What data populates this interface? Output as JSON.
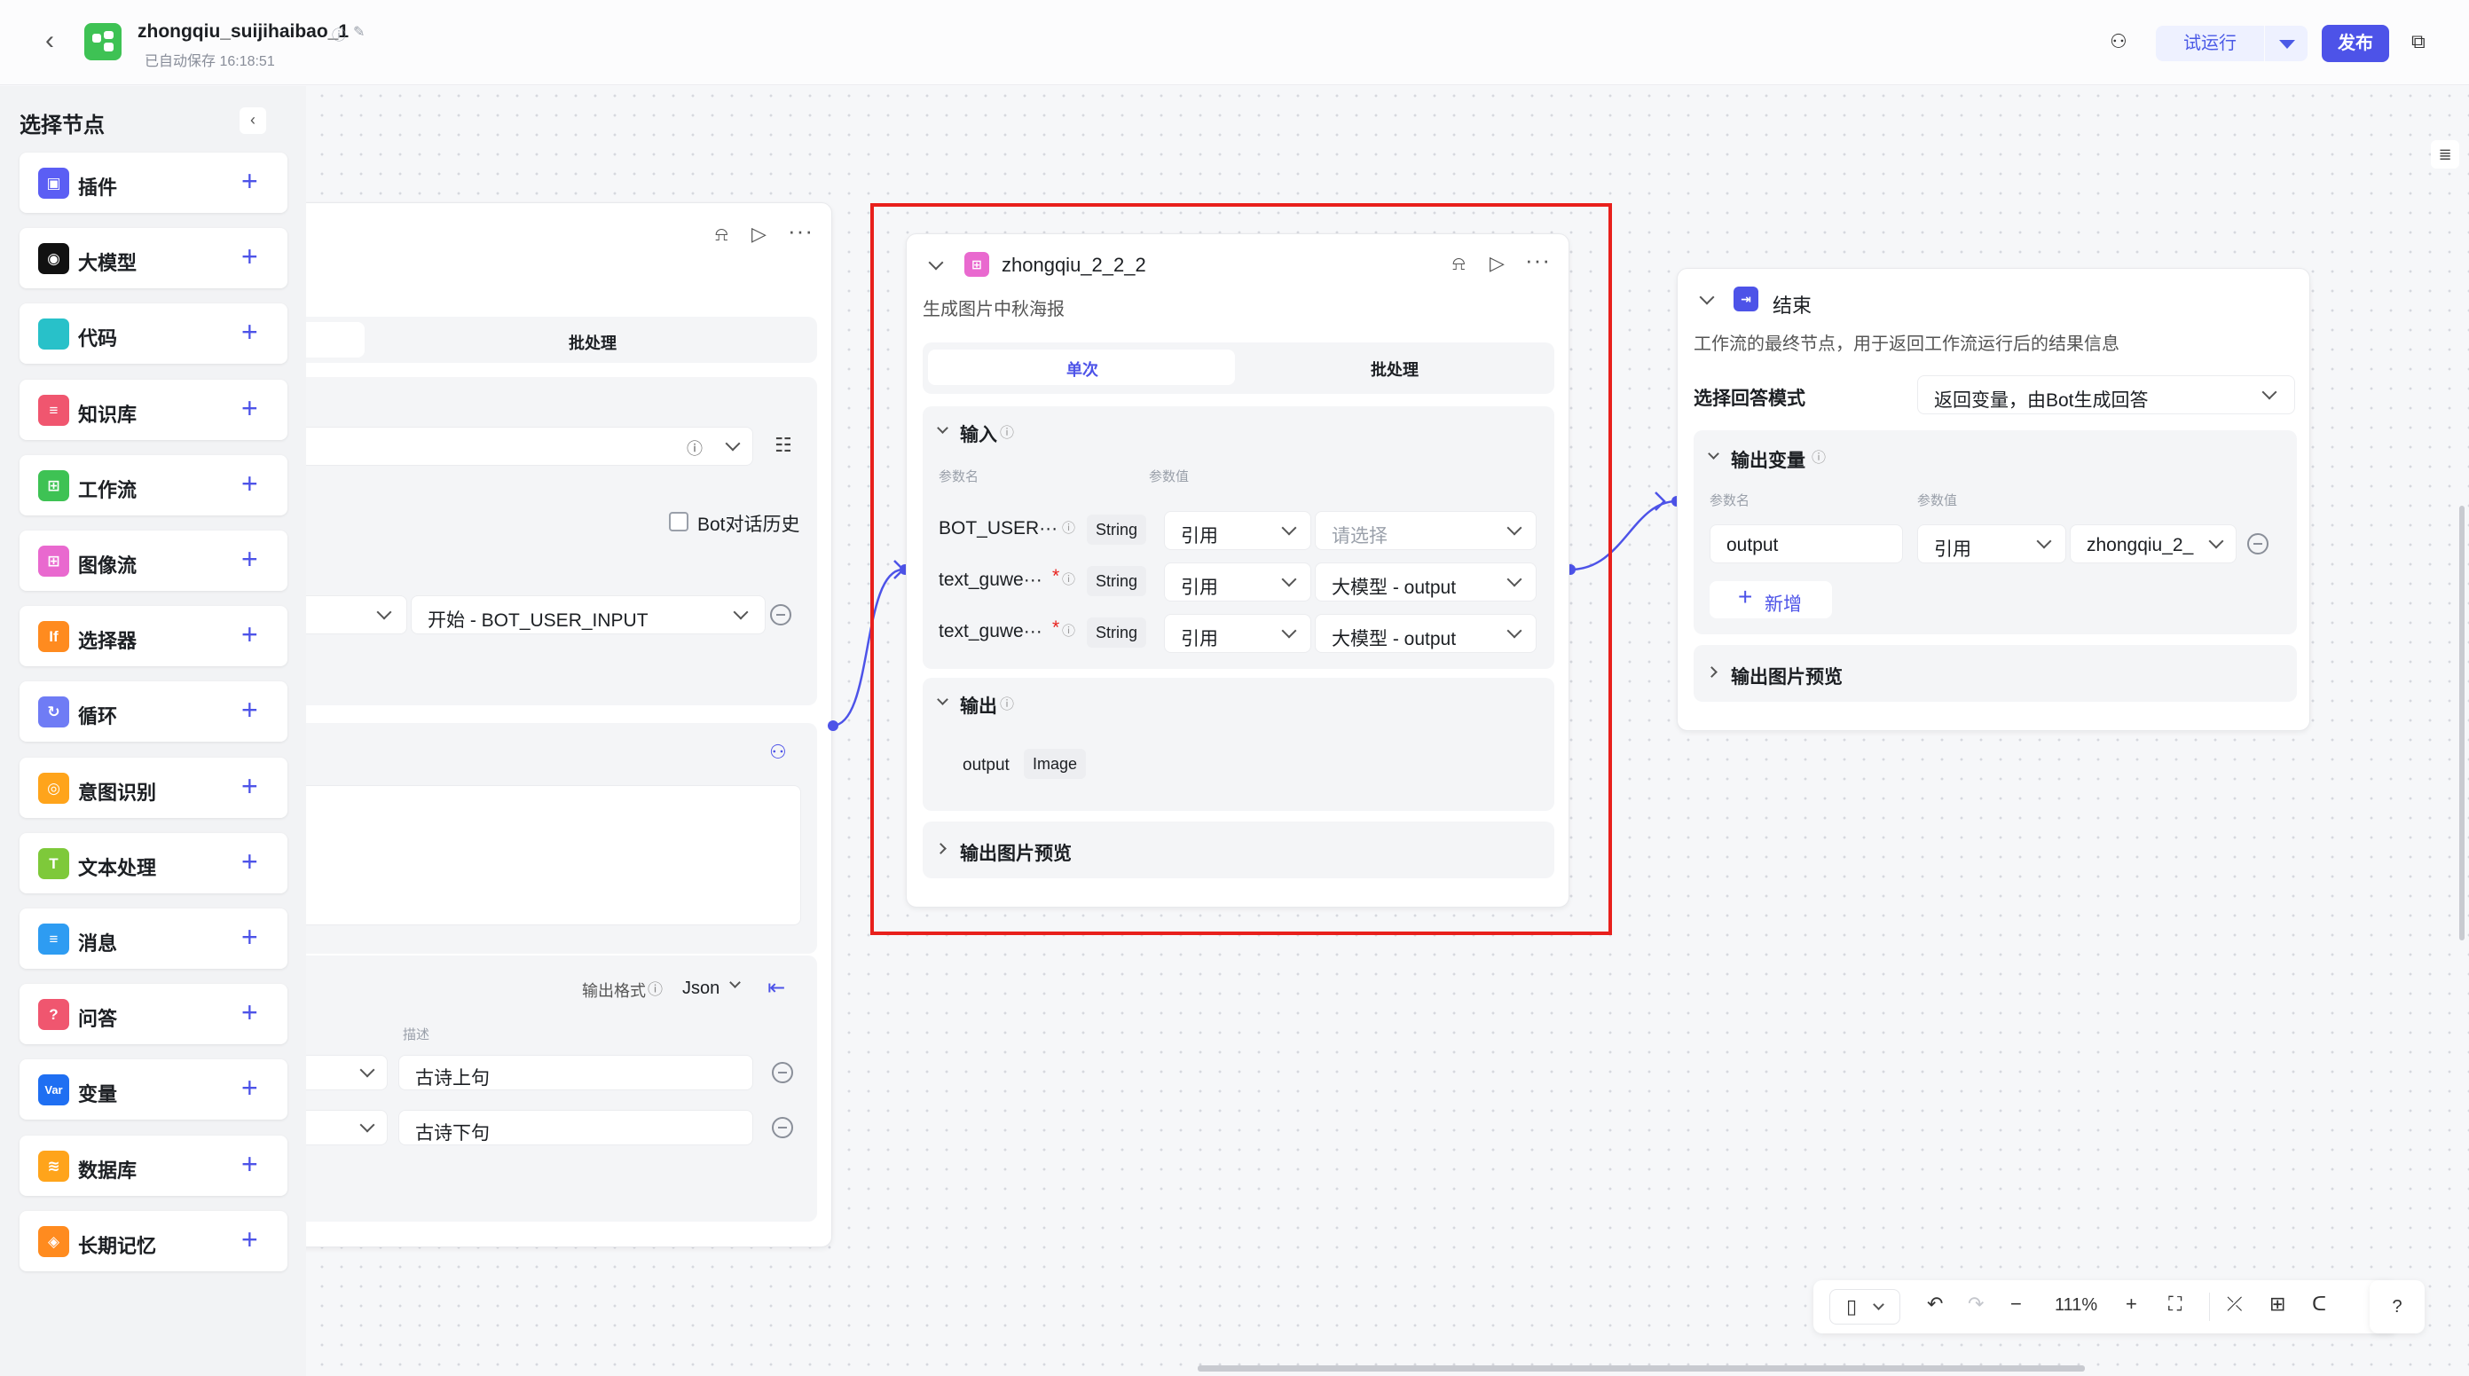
{
  "topbar": {
    "back_icon": "chevron-left-icon",
    "app_icon": "workflow-icon",
    "title": "zhongqiu_suijihaibao_1",
    "saved": "已自动保存 16:18:51",
    "try_run": "试运行",
    "publish": "发布"
  },
  "sidebar": {
    "title": "选择节点",
    "items": [
      {
        "label": "插件",
        "icon": "plugin-icon",
        "color": "#5b5ef4",
        "glyph": "▣"
      },
      {
        "label": "大模型",
        "icon": "llm-icon",
        "color": "#111111",
        "glyph": "◉"
      },
      {
        "label": "代码",
        "icon": "code-icon",
        "color": "#28c1c9",
        "glyph": "</>"
      },
      {
        "label": "知识库",
        "icon": "knowledge-icon",
        "color": "#f0566f",
        "glyph": "≡"
      },
      {
        "label": "工作流",
        "icon": "workflow-icon",
        "color": "#3ec254",
        "glyph": "⊞"
      },
      {
        "label": "图像流",
        "icon": "imageflow-icon",
        "color": "#e969cf",
        "glyph": "⊞"
      },
      {
        "label": "选择器",
        "icon": "selector-icon",
        "color": "#ff8b1f",
        "glyph": "If"
      },
      {
        "label": "循环",
        "icon": "loop-icon",
        "color": "#6f7cf5",
        "glyph": "↻"
      },
      {
        "label": "意图识别",
        "icon": "intent-icon",
        "color": "#ffa41b",
        "glyph": "◎"
      },
      {
        "label": "文本处理",
        "icon": "text-process-icon",
        "color": "#7ec93a",
        "glyph": "T"
      },
      {
        "label": "消息",
        "icon": "message-icon",
        "color": "#2e9cf2",
        "glyph": "≡"
      },
      {
        "label": "问答",
        "icon": "qa-icon",
        "color": "#f0566f",
        "glyph": "?"
      },
      {
        "label": "变量",
        "icon": "variable-icon",
        "color": "#1f6ff2",
        "glyph": "Var"
      },
      {
        "label": "数据库",
        "icon": "database-icon",
        "color": "#ffa41b",
        "glyph": "≋"
      },
      {
        "label": "长期记忆",
        "icon": "memory-icon",
        "color": "#ff8b1f",
        "glyph": "◈"
      }
    ]
  },
  "left_node": {
    "tab_batch": "批处理",
    "bot_history": "Bot对话历史",
    "value_ref": "开始 - BOT_USER_INPUT",
    "output_format_label": "输出格式",
    "output_format_value": "Json",
    "desc_header": "描述",
    "desc1": "古诗上句",
    "desc2": "古诗下句"
  },
  "middle_node": {
    "title": "zhongqiu_2_2_2",
    "subtitle": "生成图片中秋海报",
    "tab_single": "单次",
    "tab_batch": "批处理",
    "input_section": "输入",
    "param_name_header": "参数名",
    "param_value_header": "参数值",
    "rows": [
      {
        "name": "BOT_USER···",
        "required": "",
        "type": "String",
        "mode": "引用",
        "value": "请选择"
      },
      {
        "name": "text_guwe···",
        "required": "*",
        "type": "String",
        "mode": "引用",
        "value": "大模型 - output"
      },
      {
        "name": "text_guwe···",
        "required": "*",
        "type": "String",
        "mode": "引用",
        "value": "大模型 - output"
      }
    ],
    "output_section": "输出",
    "output_name": "output",
    "output_type": "Image",
    "preview": "输出图片预览"
  },
  "end_node": {
    "title": "结束",
    "subtitle": "工作流的最终节点，用于返回工作流运行后的结果信息",
    "answer_mode_label": "选择回答模式",
    "answer_mode_value": "返回变量，由Bot生成回答",
    "output_vars": "输出变量",
    "param_name_header": "参数名",
    "param_value_header": "参数值",
    "var_name": "output",
    "var_mode": "引用",
    "var_value": "zhongqiu_2_",
    "add": "新增",
    "preview": "输出图片预览"
  },
  "bottombar": {
    "zoom": "111%"
  },
  "colors": {
    "accent": "#4d53e8",
    "highlight": "#e8201c"
  }
}
